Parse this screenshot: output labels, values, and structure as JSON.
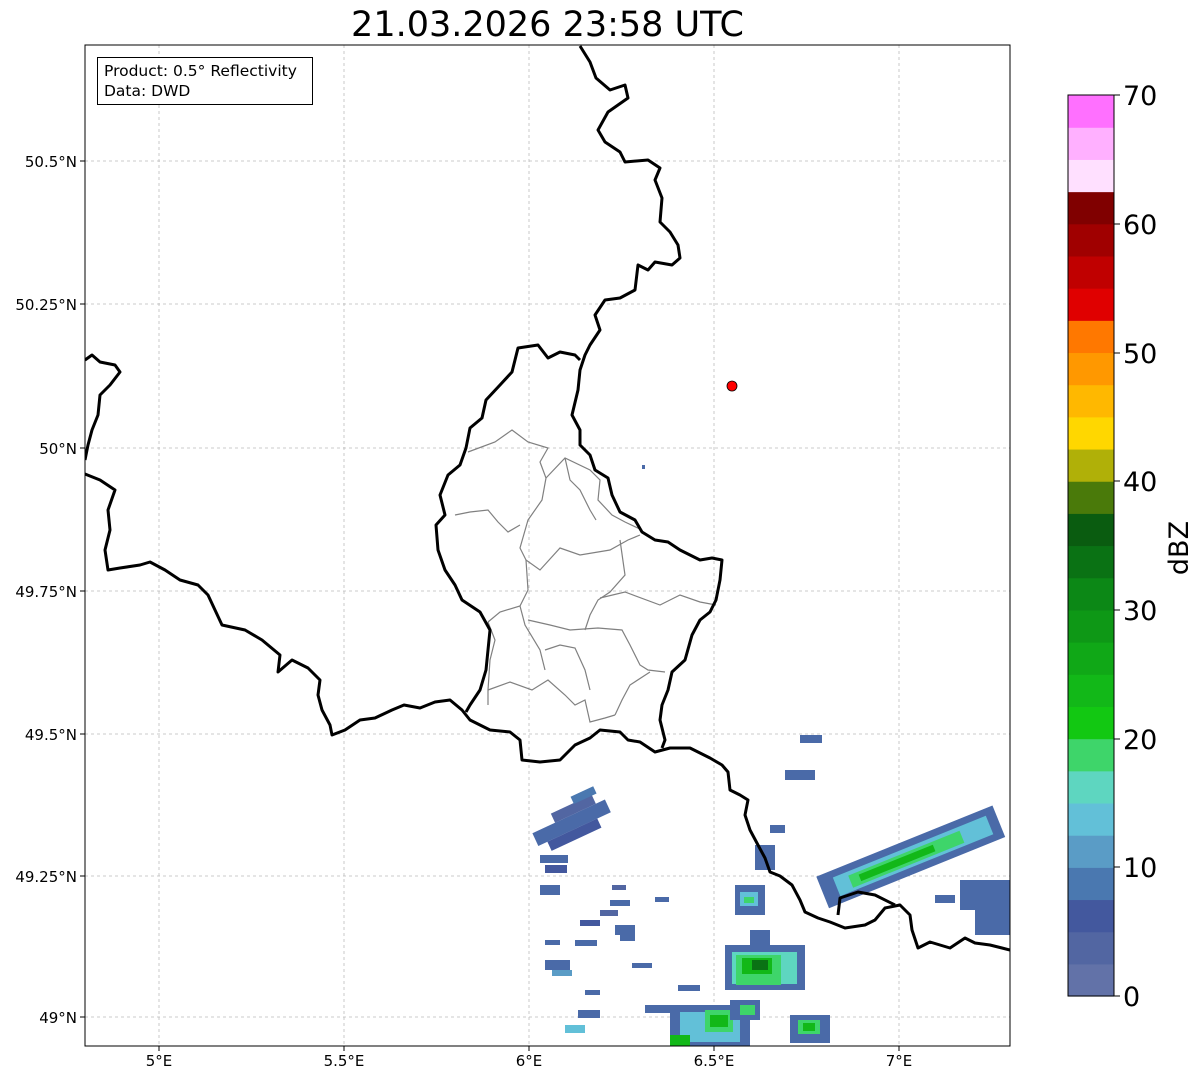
{
  "title": "21.03.2026 23:58 UTC",
  "info_box": {
    "product": "Product: 0.5° Reflectivity",
    "data": "Data: DWD"
  },
  "map": {
    "lon_range": [
      4.8,
      7.3
    ],
    "lat_range": [
      48.95,
      50.7
    ],
    "x_ticks": [
      "5°E",
      "5.5°E",
      "6°E",
      "6.5°E",
      "7°E"
    ],
    "y_ticks": [
      "50.5°N",
      "50.25°N",
      "50°N",
      "49.75°N",
      "49.5°N",
      "49.25°N",
      "49°N"
    ],
    "radar_site_color": "#ff0000"
  },
  "colorbar": {
    "label": "dBZ",
    "ticks": [
      "0",
      "10",
      "20",
      "30",
      "40",
      "50",
      "60",
      "70"
    ],
    "colors": [
      "#6272a8",
      "#5266a2",
      "#43589e",
      "#4a78b0",
      "#5a9cc6",
      "#62c0d8",
      "#5ed6c0",
      "#3ed56a",
      "#12c812",
      "#12b818",
      "#10a817",
      "#0e9816",
      "#0c8816",
      "#0a7214",
      "#0a5c10",
      "#4a7a0a",
      "#b0b008",
      "#ffd700",
      "#ffb800",
      "#ff9800",
      "#ff7800",
      "#e00000",
      "#c00000",
      "#a00000",
      "#800000",
      "#ffe0ff",
      "#ffb0ff",
      "#ff70ff",
      "#ee38ee"
    ]
  }
}
